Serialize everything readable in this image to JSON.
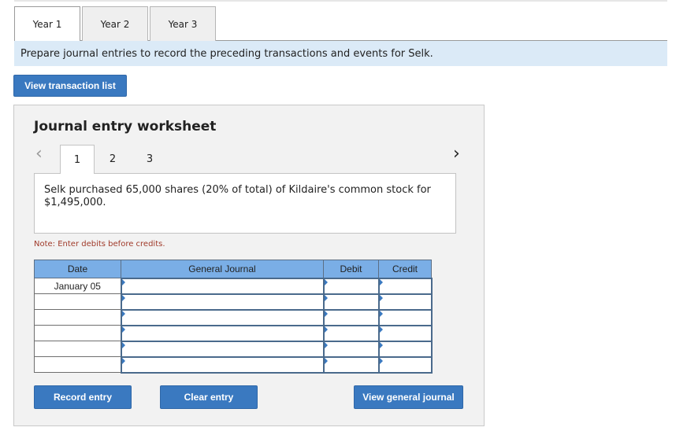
{
  "tabs": [
    {
      "label": "Year 1",
      "active": true
    },
    {
      "label": "Year 2",
      "active": false
    },
    {
      "label": "Year 3",
      "active": false
    }
  ],
  "instruction": "Prepare journal entries to record the preceding transactions and events for Selk.",
  "view_transaction_list_label": "View transaction list",
  "worksheet": {
    "title": "Journal entry worksheet",
    "entry_tabs": [
      "1",
      "2",
      "3"
    ],
    "active_entry": "1",
    "description": "Selk purchased 65,000 shares (20% of total) of Kildaire's common stock for $1,495,000.",
    "note": "Note: Enter debits before credits.",
    "table": {
      "headers": [
        "Date",
        "General Journal",
        "Debit",
        "Credit"
      ],
      "rows": [
        {
          "date": "January 05",
          "account": "",
          "debit": "",
          "credit": ""
        },
        {
          "date": "",
          "account": "",
          "debit": "",
          "credit": ""
        },
        {
          "date": "",
          "account": "",
          "debit": "",
          "credit": ""
        },
        {
          "date": "",
          "account": "",
          "debit": "",
          "credit": ""
        },
        {
          "date": "",
          "account": "",
          "debit": "",
          "credit": ""
        },
        {
          "date": "",
          "account": "",
          "debit": "",
          "credit": ""
        }
      ]
    },
    "buttons": {
      "record": "Record entry",
      "clear": "Clear entry",
      "view_general_journal": "View general journal"
    },
    "nav": {
      "prev_icon": "chevron-left-icon",
      "next_icon": "chevron-right-icon"
    }
  },
  "colors": {
    "accent": "#3a79c0",
    "header_blue": "#7aaee6",
    "instruction_bg": "#dbeaf7",
    "note_red": "#a03a2a"
  }
}
